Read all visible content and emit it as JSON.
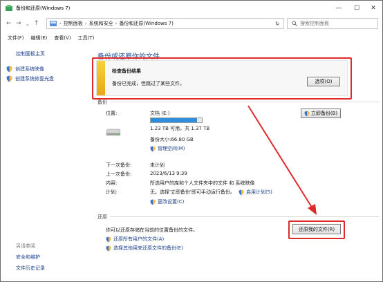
{
  "window": {
    "title": "备份和还原(Windows 7)"
  },
  "controls": {
    "minimize": "—",
    "maximize": "☐",
    "close": "✕"
  },
  "address": {
    "crumbs": [
      "控制面板",
      "系统和安全",
      "备份和还原(Windows 7)"
    ],
    "search_placeholder": "搜索控制面板"
  },
  "menu": [
    "文件(F)",
    "编辑(E)",
    "查看(V)",
    "工具(T)"
  ],
  "sidebar": {
    "home": "控制面板主页",
    "items": [
      "创建系统映像",
      "创建系统修复光盘"
    ],
    "see_also_header": "另请参阅",
    "see_also": [
      "安全和维护",
      "文件历史记录"
    ]
  },
  "main": {
    "heading": "备份或还原你的文件",
    "status": {
      "title": "检查备份结果",
      "message": "备份已完成，但跳过了某些文件。",
      "options_button": "选项(O)"
    },
    "backup": {
      "section": "备份",
      "location_label": "位置:",
      "drive_name": "文档 (E:)",
      "drive_usage_fraction": 0.9,
      "drive_space": "1.23 TB 可用，共 1.37 TB",
      "backup_size": "备份大小:66.80 GB",
      "manage_space": "管理空间(M)",
      "backup_now_button": "立即备份(B)",
      "next_label": "下一次备份:",
      "next_value": "未计划",
      "last_label": "上一次备份:",
      "last_value": "2023/6/13 9:39",
      "content_label": "内容:",
      "content_value": "所选用户的库和个人文件夹中的文件 和 系统映像",
      "schedule_label": "计划:",
      "schedule_value": "无。选择'立即备份'即可手动运行备份。",
      "enable_schedule": "启用计划(S)",
      "change_settings": "更改设置(C)"
    },
    "restore": {
      "section": "还原",
      "text": "你可以还原存储在当前的位置备份的文件。",
      "restore_button": "还原我的文件(R)",
      "restore_all_users": "还原所有用户的文件(A)",
      "select_other": "选择其他用来还原文件的备份(E)"
    }
  },
  "colors": {
    "link": "#1a3e8c",
    "heading": "#1e4e96",
    "highlight": "#e02a2a",
    "status_bar": "#f0b72a"
  }
}
